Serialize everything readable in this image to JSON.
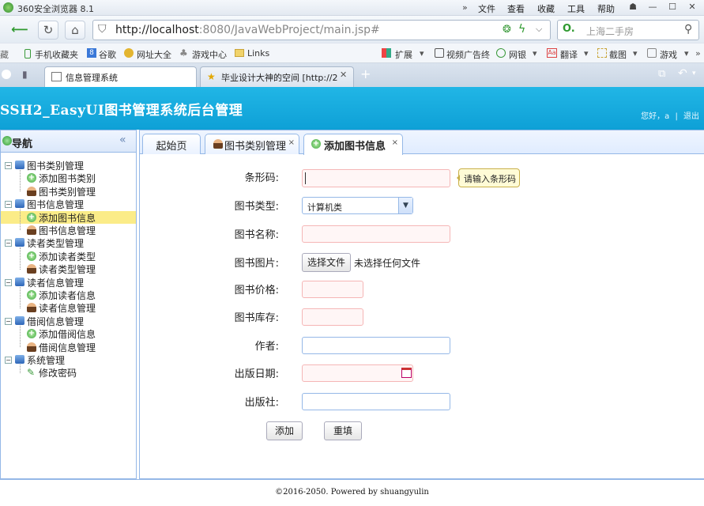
{
  "browser": {
    "title": "360安全浏览器 8.1",
    "menus": [
      "文件",
      "查看",
      "收藏",
      "工具",
      "帮助"
    ],
    "url_host": "http://localhost",
    "url_rest": ":8080/JavaWebProject/main.jsp#",
    "search_placeholder": "上海二手房",
    "favorites": [
      "手机收藏夹",
      "谷歌",
      "网址大全",
      "游戏中心",
      "Links"
    ],
    "favorites_right": [
      "扩展",
      "视频广告终",
      "网银",
      "翻译",
      "截图",
      "游戏"
    ],
    "tabs": [
      {
        "label": "信息管理系统",
        "active": true
      },
      {
        "label": "毕业设计大神的空间 [http://2",
        "active": false
      }
    ]
  },
  "app": {
    "title": "SSH2_EasyUI图书管理系统后台管理",
    "welcome": "您好，a",
    "separator": "|",
    "logout": "退出"
  },
  "sidebar": {
    "title": "导航",
    "collapse_icon": "«",
    "groups": [
      {
        "label": "图书类别管理",
        "items": [
          {
            "label": "添加图书类别",
            "icon": "add"
          },
          {
            "label": "图书类别管理",
            "icon": "user"
          }
        ]
      },
      {
        "label": "图书信息管理",
        "items": [
          {
            "label": "添加图书信息",
            "icon": "add",
            "selected": true
          },
          {
            "label": "图书信息管理",
            "icon": "user"
          }
        ]
      },
      {
        "label": "读者类型管理",
        "items": [
          {
            "label": "添加读者类型",
            "icon": "add"
          },
          {
            "label": "读者类型管理",
            "icon": "user"
          }
        ]
      },
      {
        "label": "读者信息管理",
        "items": [
          {
            "label": "添加读者信息",
            "icon": "add"
          },
          {
            "label": "读者信息管理",
            "icon": "user"
          }
        ]
      },
      {
        "label": "借阅信息管理",
        "items": [
          {
            "label": "添加借阅信息",
            "icon": "add"
          },
          {
            "label": "借阅信息管理",
            "icon": "user"
          }
        ]
      },
      {
        "label": "系统管理",
        "items": [
          {
            "label": "修改密码",
            "icon": "pen"
          }
        ]
      }
    ]
  },
  "page_tabs": [
    {
      "label": "起始页",
      "closable": false
    },
    {
      "label": "图书类别管理",
      "closable": true
    },
    {
      "label": "添加图书信息",
      "closable": true,
      "active": true
    }
  ],
  "form": {
    "barcode_label": "条形码:",
    "barcode_tip": "请输入条形码",
    "type_label": "图书类型:",
    "type_value": "计算机类",
    "name_label": "图书名称:",
    "image_label": "图书图片:",
    "file_button": "选择文件",
    "file_status": "未选择任何文件",
    "price_label": "图书价格:",
    "stock_label": "图书库存:",
    "author_label": "作者:",
    "date_label": "出版日期:",
    "publisher_label": "出版社:",
    "add_button": "添加",
    "reset_button": "重填"
  },
  "footer": "©2016-2050. Powered by shuangyulin",
  "colors": {
    "header": "#0ea0d6",
    "border": "#95b8e7",
    "selected": "#fbec88",
    "invalid": "#f5b6b6"
  }
}
